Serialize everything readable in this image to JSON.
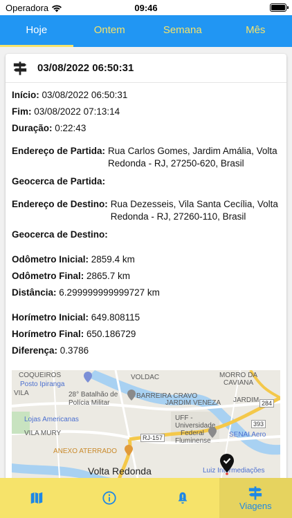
{
  "status_bar": {
    "carrier": "Operadora",
    "time": "09:46"
  },
  "tabs": [
    {
      "label": "Hoje"
    },
    {
      "label": "Ontem"
    },
    {
      "label": "Semana"
    },
    {
      "label": "Mês"
    }
  ],
  "trip": {
    "header_title": "03/08/2022 06:50:31",
    "inicio_label": "Início:",
    "inicio_value": "03/08/2022 06:50:31",
    "fim_label": "Fim:",
    "fim_value": "03/08/2022 07:13:14",
    "duracao_label": "Duração:",
    "duracao_value": "0:22:43",
    "partida_label": "Endereço de Partida:",
    "partida_value": "Rua Carlos Gomes, Jardim Amália, Volta Redonda - RJ, 27250-620, Brasil",
    "geocerca_partida_label": "Geocerca de Partida:",
    "destino_label": "Endereço de Destino:",
    "destino_value": "Rua Dezesseis, Vila Santa Cecília, Volta Redonda - RJ, 27260-110, Brasil",
    "geocerca_destino_label": "Geocerca de Destino:",
    "odometro_inicial_label": "Odômetro Inicial:",
    "odometro_inicial_value": "2859.4 km",
    "odometro_final_label": "Odômetro Final:",
    "odometro_final_value": "2865.7 km",
    "distancia_label": "Distância:",
    "distancia_value": "6.299999999999727 km",
    "horimetro_inicial_label": "Horímetro Inicial:",
    "horimetro_inicial_value": "649.808115",
    "horimetro_final_label": "Horímetro Final:",
    "horimetro_final_value": "650.186729",
    "diferenca_label": "Diferença:",
    "diferenca_value": "0.3786"
  },
  "map": {
    "labels": {
      "coqueiros": "COQUEIROS",
      "posto": "Posto Ipiranga",
      "voldac": "VOLDAC",
      "morro_da_caviana_1": "MORRO DA",
      "morro_da_caviana_2": "CAVIANA",
      "vila": "VILA",
      "batalhao_1": "28° Batalhão de",
      "batalhao_2": "Polícia Militar",
      "barreira": "BARREIRA CRAVO",
      "jardim_veneza": "JARDIM VENEZA",
      "jardim": "JARDIM",
      "lojas": "Lojas Americanas",
      "uff_1": "UFF -",
      "uff_2": "Universidade",
      "uff_3": "Federal",
      "uff_4": "Fluminense",
      "vila_mury": "VILA MURY",
      "senai": "SENAI Aero",
      "anexo": "ANEXO ATERRADO",
      "volta_redonda": "Volta Redonda",
      "luiz": "Luiz Intermediações",
      "rj157": "RJ-157",
      "r393": "393",
      "r284": "284"
    }
  },
  "bottom_nav": [
    {
      "icon": "map-icon",
      "label": ""
    },
    {
      "icon": "info-icon",
      "label": ""
    },
    {
      "icon": "bell-alert-icon",
      "label": ""
    },
    {
      "icon": "signpost-icon",
      "label": "Viagens"
    }
  ],
  "colors": {
    "tab_bar": "#2196f3",
    "accent_yellow": "#f6e36a",
    "nav_icon": "#1e88e5"
  }
}
